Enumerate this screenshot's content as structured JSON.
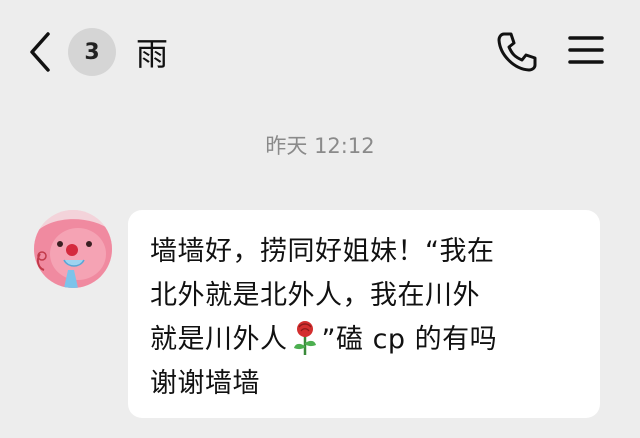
{
  "header": {
    "back_icon": "chevron-left-icon",
    "unread_count": "3",
    "title": "雨",
    "phone_icon": "phone-icon",
    "menu_icon": "hamburger-menu-icon"
  },
  "messages": [
    {
      "timestamp": "昨天 12:12",
      "sender_avatar_icon": "cartoon-character-avatar",
      "lines": [
        "墙墙好，捞同好姐妹！“我在",
        "北外就是北外人，我在川外",
        "就是川外人",
        "”磕 cp 的有吗",
        "谢谢墙墙"
      ],
      "emoji": "rose-emoji"
    }
  ],
  "colors": {
    "background": "#ededed",
    "bubble": "#ffffff",
    "badge": "#d5d5d5",
    "timestamp_text": "#8a8a8a"
  }
}
